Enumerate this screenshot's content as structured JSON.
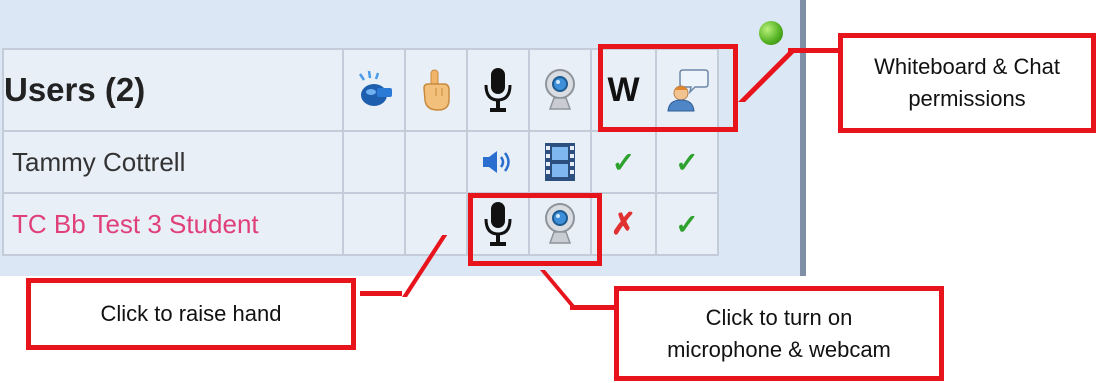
{
  "users_panel": {
    "title": "Users (2)",
    "status_color": "#4fae1e",
    "header_icons": [
      "whistle-icon",
      "raise-hand-icon",
      "microphone-icon",
      "webcam-icon",
      "whiteboard-permission",
      "chat-permission-icon"
    ],
    "whiteboard_header": "W",
    "users": [
      {
        "name": "Tammy Cottrell",
        "color": "#333333",
        "audio": "speaker-icon",
        "video": "film-icon",
        "whiteboard": "✓",
        "chat": "✓"
      },
      {
        "name": "TC Bb Test 3 Student",
        "color": "#e0407a",
        "audio": "microphone-icon",
        "video": "webcam-icon",
        "whiteboard": "✗",
        "chat": "✓"
      }
    ]
  },
  "callouts": {
    "permissions": "Whiteboard & Chat permissions",
    "raise_hand": "Click to raise hand",
    "mic_webcam": "Click to turn on microphone & webcam"
  }
}
